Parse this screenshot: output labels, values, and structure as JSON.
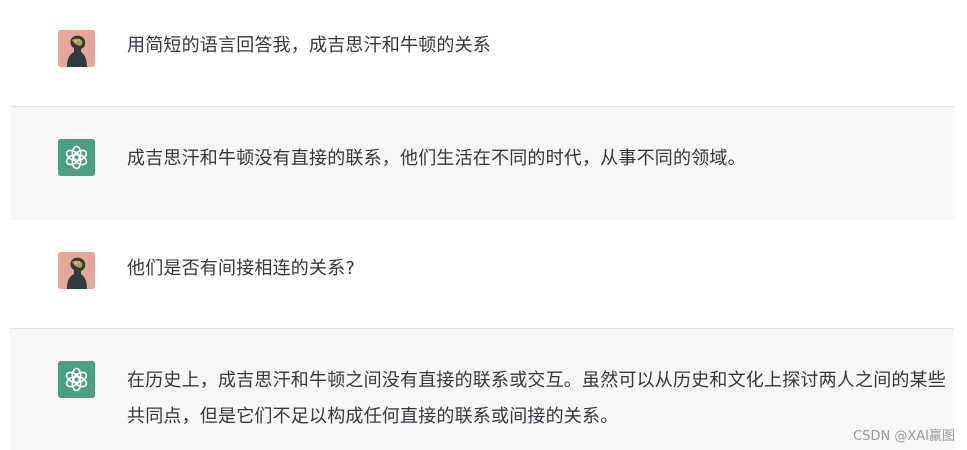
{
  "conversation": {
    "messages": [
      {
        "role": "user",
        "text": "用简短的语言回答我，成吉思汗和牛顿的关系"
      },
      {
        "role": "assistant",
        "text": "成吉思汗和牛顿没有直接的联系，他们生活在不同的时代，从事不同的领域。"
      },
      {
        "role": "user",
        "text": "他们是否有间接相连的关系?"
      },
      {
        "role": "assistant",
        "text": "在历史上，成吉思汗和牛顿之间没有直接的联系或交互。虽然可以从历史和文化上探讨两人之间的某些共同点，但是它们不足以构成任何直接的联系或间接的关系。"
      }
    ]
  },
  "watermark": "CSDN @XAI羸图",
  "icons": {
    "user_avatar": "user-portrait-avatar-icon",
    "assistant_avatar": "openai-logo-icon"
  },
  "colors": {
    "assistant_row_bg": "#f7f7f8",
    "assistant_avatar_bg": "#4aa181",
    "user_avatar_bg": "#e3a89a",
    "text": "#353740"
  }
}
